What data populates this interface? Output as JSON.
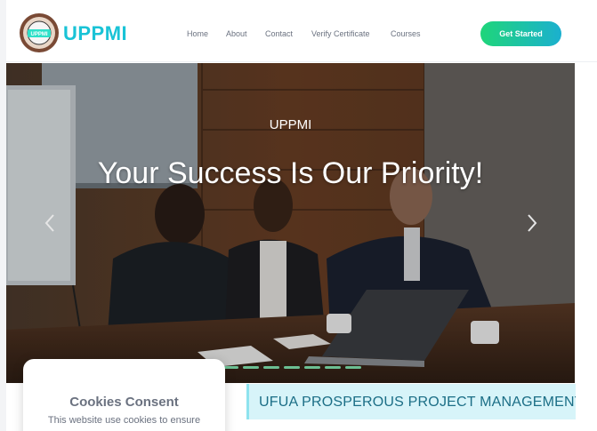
{
  "header": {
    "brand": "UPPMI",
    "logo_text": "UPPMI",
    "nav": [
      {
        "label": "Home"
      },
      {
        "label": "About"
      },
      {
        "label": "Contact"
      },
      {
        "label": "Verify Certificate"
      },
      {
        "label": "Courses"
      }
    ],
    "cta_label": "Get Started"
  },
  "hero": {
    "kicker": "UPPMI",
    "headline": "Your Success Is Our Priority!",
    "prev_icon": "chevron-left-icon",
    "next_icon": "chevron-right-icon",
    "slide_count": 8,
    "active_slide": 1
  },
  "banner": {
    "text": "UFUA PROSPEROUS PROJECT MANAGEMENT"
  },
  "cookie_consent": {
    "title": "Cookies Consent",
    "text": "This website use cookies to ensure"
  },
  "colors": {
    "brand": "#19c3d6",
    "cta_start": "#1fd57a",
    "cta_end": "#1bb0cf",
    "banner_bg": "#d7f4f9",
    "banner_text": "#1b6e86"
  }
}
